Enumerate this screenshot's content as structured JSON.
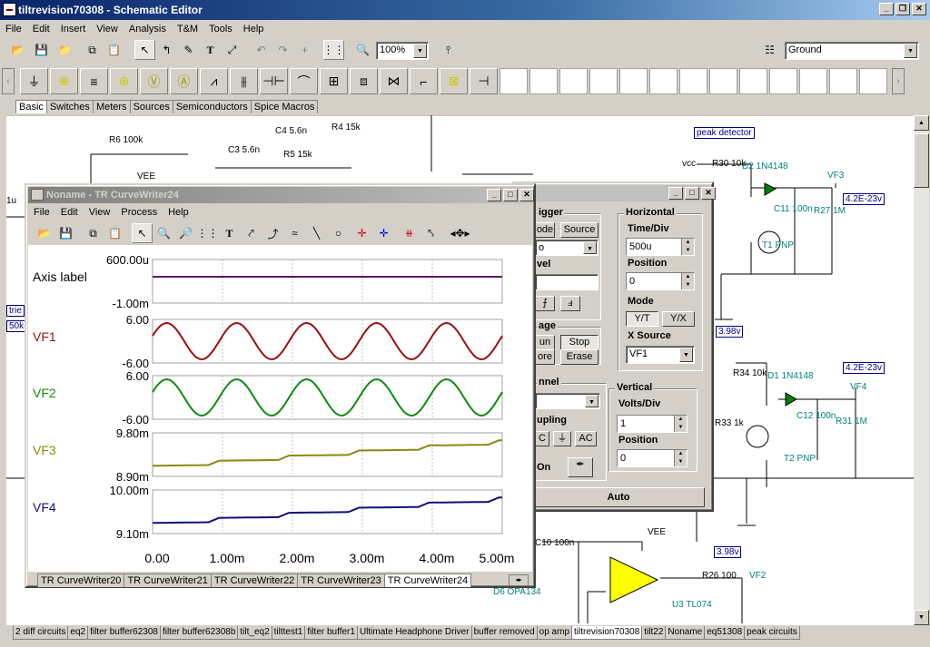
{
  "app": {
    "title": "tiltrevision70308 - Schematic Editor"
  },
  "menu": [
    "File",
    "Edit",
    "Insert",
    "View",
    "Analysis",
    "T&M",
    "Tools",
    "Help"
  ],
  "toolbar": {
    "zoom": "100%",
    "node_select": "Ground"
  },
  "parts_tabs": [
    "Basic",
    "Switches",
    "Meters",
    "Sources",
    "Semiconductors",
    "Spice Macros"
  ],
  "schematic": {
    "labels": [
      "R6 100k",
      "VEE",
      "C3 5.6n",
      "R5 15k",
      "C4 5.6n",
      "R4 15k",
      "R30 10k",
      "D2 1N4148",
      "VF3",
      "C11 100n",
      "T1 PNP",
      "R27 1M",
      "R34 10k",
      "D1 1N4148",
      "R33 1k",
      "C12 100n",
      "T2 PNP",
      "R31 1M",
      "VF4",
      "C10 100n",
      "VEE",
      "R26 100",
      "VF2",
      "U3 TL074",
      "D6 OPA134",
      "vcc",
      "1u"
    ],
    "boxes": [
      "peak detector",
      "4.2E-23v",
      "3.98v",
      "4.2E-23v",
      "3.98v",
      "trie",
      "50k"
    ]
  },
  "curvewriter": {
    "title": "Noname - TR CurveWriter24",
    "menu": [
      "File",
      "Edit",
      "View",
      "Process",
      "Help"
    ],
    "rows": [
      {
        "name": "Axis label",
        "top": "600.00u",
        "bottom": "-1.00m",
        "color": "#5a1a6a"
      },
      {
        "name": "VF1",
        "top": "6.00",
        "bottom": "-6.00",
        "color": "#9a1010"
      },
      {
        "name": "VF2",
        "top": "6.00",
        "bottom": "-6.00",
        "color": "#108a10"
      },
      {
        "name": "VF3",
        "top": "9.80m",
        "bottom": "8.90m",
        "color": "#8a8a10"
      },
      {
        "name": "VF4",
        "top": "10.00m",
        "bottom": "9.10m",
        "color": "#10107a"
      }
    ],
    "xticks": [
      "0.00",
      "1.00m",
      "2.00m",
      "3.00m",
      "4.00m",
      "5.00m"
    ],
    "tabs": [
      "TR CurveWriter20",
      "TR CurveWriter21",
      "TR CurveWriter22",
      "TR CurveWriter23",
      "TR CurveWriter24"
    ]
  },
  "oscilloscope": {
    "trigger": {
      "label": "igger",
      "mode": "ode",
      "source": "Source",
      "select": "o",
      "level": "vel"
    },
    "storage": {
      "label": "age",
      "run": "un",
      "stop": "Stop",
      "store": "ore",
      "erase": "Erase"
    },
    "channel": {
      "label": "nnel",
      "coupling": "upling",
      "ac": "AC",
      "dc": "C",
      "on": "On"
    },
    "horizontal": {
      "label": "Horizontal",
      "time_div_label": "Time/Div",
      "time_div": "500u",
      "position_label": "Position",
      "position": "0",
      "mode_label": "Mode",
      "yt": "Y/T",
      "yx": "Y/X",
      "xsource_label": "X Source",
      "xsource": "VF1"
    },
    "vertical": {
      "label": "Vertical",
      "volts_div_label": "Volts/Div",
      "volts_div": "1",
      "position_label": "Position",
      "position": "0"
    },
    "auto": "Auto"
  },
  "doc_tabs": [
    "2 diff circuits",
    "eq2",
    "filter buffer62308",
    "filter buffer62308b",
    "tilt_eq2",
    "tilttest1",
    "filter buffer1",
    "Ultimate Headphone Driver",
    "buffer removed",
    "op amp",
    "tiltrevision70308",
    "tilt22",
    "Noname",
    "eq51308",
    "peak circuits"
  ]
}
